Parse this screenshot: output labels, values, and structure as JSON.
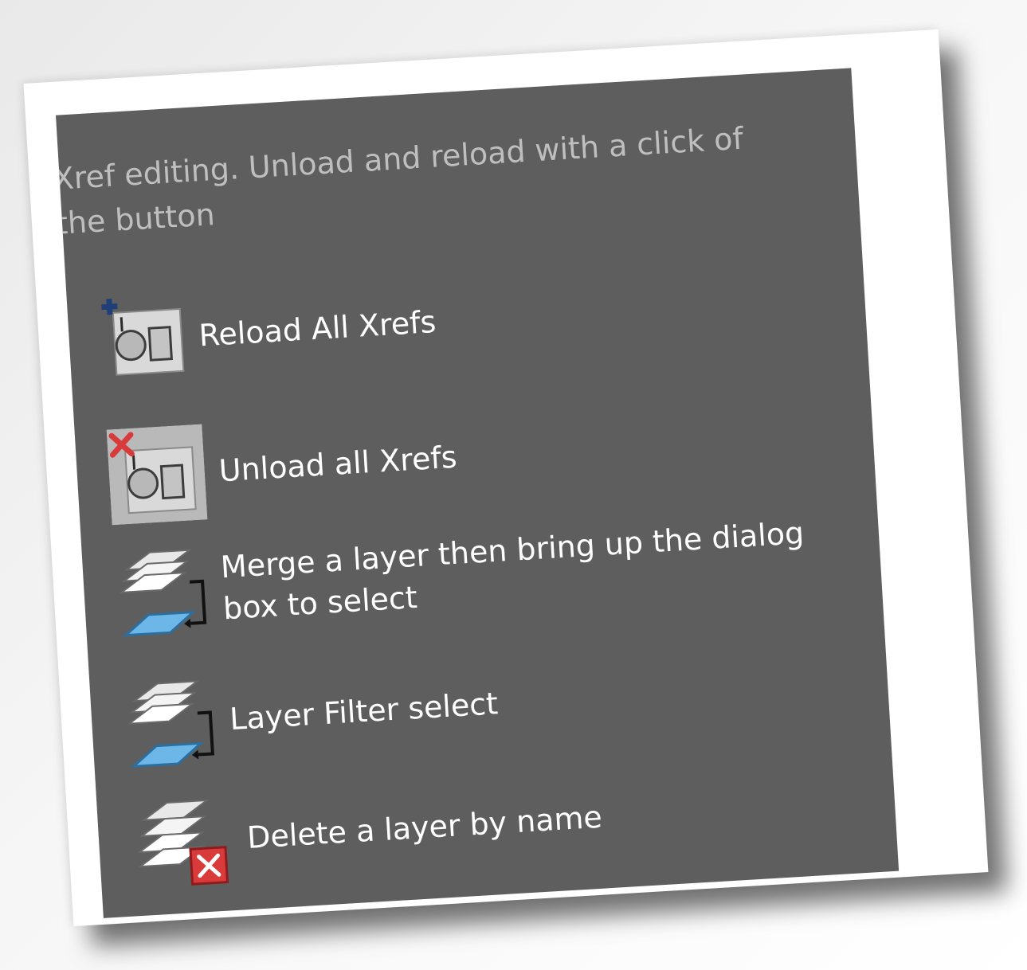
{
  "panel": {
    "description": "Xref editing. Unload and reload with a click of\nthe button"
  },
  "items": [
    {
      "label": "Reload All Xrefs",
      "icon": "reload-xrefs-icon"
    },
    {
      "label": "Unload all Xrefs",
      "icon": "unload-xrefs-icon"
    },
    {
      "label": "Merge a layer then bring up the dialog\nbox to select",
      "icon": "layer-merge-icon"
    },
    {
      "label": "Layer Filter select",
      "icon": "layer-filter-icon"
    },
    {
      "label": "Delete a layer by name",
      "icon": "layer-delete-icon"
    }
  ],
  "colors": {
    "panel_bg": "#5e5e5e",
    "description_text": "#bfbfbf",
    "label_text": "#ffffff",
    "plus_accent": "#1f3f78",
    "delete_accent": "#d93a3a"
  }
}
